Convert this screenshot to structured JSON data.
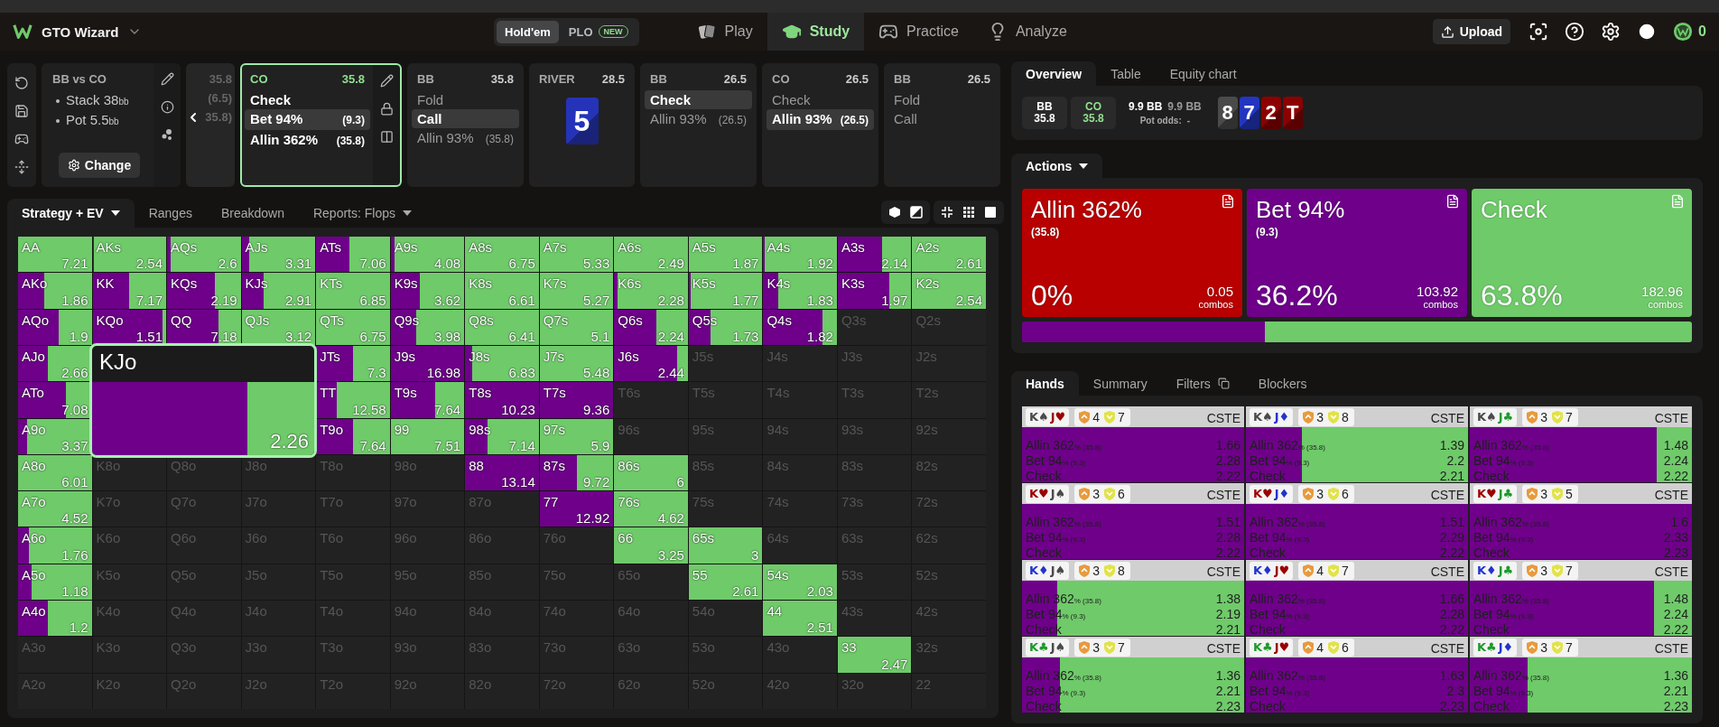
{
  "nav": {
    "brand": "GTO Wizard",
    "games": [
      {
        "label": "Hold'em",
        "selected": true
      },
      {
        "label": "PLO",
        "badge": "NEW",
        "selected": false
      }
    ],
    "links": [
      {
        "label": "Play",
        "kind": "play",
        "selected": false
      },
      {
        "label": "Study",
        "kind": "study",
        "selected": true
      },
      {
        "label": "Practice",
        "kind": "practice",
        "selected": false
      },
      {
        "label": "Analyze",
        "kind": "analyze",
        "selected": false
      }
    ],
    "upload": "Upload",
    "coins": "0"
  },
  "spot": {
    "title": "BB vs CO",
    "stats": [
      "Stack 38$_{bb}$",
      "Pot 5.5$_{bb}$"
    ],
    "change": "Change"
  },
  "hidden_card": {
    "lines": [
      "35.8",
      "(6.5)",
      "35.8)"
    ]
  },
  "line": [
    {
      "kind": "player",
      "position": "CO",
      "stack": "35.8",
      "selected": true,
      "options": [
        {
          "label": "Check",
          "selected": false
        },
        {
          "label": "Bet 94%",
          "amount": "(9.3)",
          "selected": true
        },
        {
          "label": "Allin 362%",
          "amount": "(35.8)",
          "selected": false
        }
      ]
    },
    {
      "kind": "player",
      "position": "BB",
      "stack": "35.8",
      "selected": false,
      "options": [
        {
          "label": "Fold",
          "selected": false
        },
        {
          "label": "Call",
          "selected": true
        },
        {
          "label": "Allin 93%",
          "amount": "(35.8)",
          "selected": false
        }
      ]
    },
    {
      "kind": "street",
      "position": "RIVER",
      "stack": "28.5",
      "selected": false,
      "card": {
        "rank": "5",
        "color": "#2433b8"
      }
    },
    {
      "kind": "player",
      "position": "BB",
      "stack": "26.5",
      "selected": false,
      "options": [
        {
          "label": "Check",
          "selected": true
        },
        {
          "label": "Allin 93%",
          "amount": "(26.5)",
          "selected": false
        }
      ]
    },
    {
      "kind": "player",
      "position": "CO",
      "stack": "26.5",
      "selected": false,
      "options": [
        {
          "label": "Check",
          "selected": false
        },
        {
          "label": "Allin 93%",
          "amount": "(26.5)",
          "selected": true
        }
      ]
    },
    {
      "kind": "player",
      "position": "BB",
      "stack": "26.5",
      "selected": false,
      "options": [
        {
          "label": "Fold",
          "selected": false
        },
        {
          "label": "Call",
          "selected": false
        }
      ]
    }
  ],
  "grid_tabs": [
    {
      "label": "Strategy + EV",
      "dropdown": true,
      "selected": true
    },
    {
      "label": "Ranges",
      "dropdown": false,
      "selected": false
    },
    {
      "label": "Breakdown",
      "dropdown": false,
      "selected": false
    },
    {
      "label": "Reports: Flops",
      "dropdown": true,
      "selected": false
    }
  ],
  "grid": {
    "rows": [
      [
        {
          "hand": "AA",
          "in_range": true,
          "ev": "7.21"
        },
        {
          "hand": "AKs",
          "in_range": true,
          "ev": "2.54",
          "bet": {
            "level": 0.02
          }
        },
        {
          "hand": "AQs",
          "in_range": true,
          "ev": "2.6",
          "bet": {
            "level": 0.05
          }
        },
        {
          "hand": "AJs",
          "in_range": true,
          "ev": "3.31",
          "bet": {
            "level": 0.1
          }
        },
        {
          "hand": "ATs",
          "in_range": true,
          "ev": "7.06",
          "bet": {
            "level": 0.45
          }
        },
        {
          "hand": "A9s",
          "in_range": true,
          "ev": "4.08",
          "bet": {
            "level": 0.05
          }
        },
        {
          "hand": "A8s",
          "in_range": true,
          "ev": "6.75"
        },
        {
          "hand": "A7s",
          "in_range": true,
          "ev": "5.33"
        },
        {
          "hand": "A6s",
          "in_range": true,
          "ev": "2.49"
        },
        {
          "hand": "A5s",
          "in_range": true,
          "ev": "1.87"
        },
        {
          "hand": "A4s",
          "in_range": true,
          "ev": "1.92",
          "bet": {
            "level": 0.02
          }
        },
        {
          "hand": "A3s",
          "in_range": true,
          "ev": "2.14",
          "bet": {
            "level": 0.6
          }
        },
        {
          "hand": "A2s",
          "in_range": true,
          "ev": "2.61"
        }
      ],
      [
        {
          "hand": "AKo",
          "in_range": true,
          "ev": "1.86",
          "bet": {
            "level": 0.35
          }
        },
        {
          "hand": "KK",
          "in_range": true,
          "ev": "7.17",
          "bet": {
            "level": 0.5
          }
        },
        {
          "hand": "KQs",
          "in_range": true,
          "ev": "2.19",
          "bet": {
            "level": 0.65
          }
        },
        {
          "hand": "KJs",
          "in_range": true,
          "ev": "2.91",
          "bet": {
            "level": 0.3
          }
        },
        {
          "hand": "KTs",
          "in_range": true,
          "ev": "6.85"
        },
        {
          "hand": "K9s",
          "in_range": true,
          "ev": "3.62",
          "bet": {
            "level": 0.4
          }
        },
        {
          "hand": "K8s",
          "in_range": true,
          "ev": "6.61"
        },
        {
          "hand": "K7s",
          "in_range": true,
          "ev": "5.27"
        },
        {
          "hand": "K6s",
          "in_range": true,
          "ev": "2.28",
          "bet": {
            "level": 0.05
          }
        },
        {
          "hand": "K5s",
          "in_range": true,
          "ev": "1.77",
          "bet": {
            "level": 0.03
          }
        },
        {
          "hand": "K4s",
          "in_range": true,
          "ev": "1.83",
          "bet": {
            "level": 0.2
          }
        },
        {
          "hand": "K3s",
          "in_range": true,
          "ev": "1.97",
          "bet": {
            "level": 0.7
          }
        },
        {
          "hand": "K2s",
          "in_range": true,
          "ev": "2.54"
        }
      ],
      [
        {
          "hand": "AQo",
          "in_range": true,
          "ev": "1.9",
          "bet": {
            "level": 0.55
          }
        },
        {
          "hand": "KQo",
          "in_range": true,
          "ev": "1.51",
          "bet": {
            "level": 0.95
          }
        },
        {
          "hand": "QQ",
          "in_range": true,
          "ev": "7.18",
          "bet": {
            "level": 0.7
          }
        },
        {
          "hand": "QJs",
          "in_range": true,
          "ev": "3.12"
        },
        {
          "hand": "QTs",
          "in_range": true,
          "ev": "6.75"
        },
        {
          "hand": "Q9s",
          "in_range": true,
          "ev": "3.98",
          "bet": {
            "level": 0.35
          }
        },
        {
          "hand": "Q8s",
          "in_range": true,
          "ev": "6.41"
        },
        {
          "hand": "Q7s",
          "in_range": true,
          "ev": "5.1"
        },
        {
          "hand": "Q6s",
          "in_range": true,
          "ev": "2.24",
          "bet": {
            "level": 0.57
          }
        },
        {
          "hand": "Q5s",
          "in_range": true,
          "ev": "1.73",
          "bet": {
            "level": 0.3
          }
        },
        {
          "hand": "Q4s",
          "in_range": true,
          "ev": "1.82",
          "bet": {
            "level": 0.8
          }
        },
        {
          "hand": "Q3s",
          "in_range": false
        },
        {
          "hand": "Q2s",
          "in_range": false
        }
      ],
      [
        {
          "hand": "AJo",
          "in_range": true,
          "ev": "2.66",
          "bet": {
            "level": 0.4
          }
        },
        null,
        null,
        null,
        {
          "hand": "JTs",
          "in_range": true,
          "ev": "7.3",
          "bet": {
            "level": 0.5
          }
        },
        {
          "hand": "J9s",
          "in_range": true,
          "ev": "16.98",
          "bet": {
            "level": 1
          }
        },
        {
          "hand": "J8s",
          "in_range": true,
          "ev": "6.83",
          "bet": {
            "level": 0.1
          }
        },
        {
          "hand": "J7s",
          "in_range": true,
          "ev": "5.48"
        },
        {
          "hand": "J6s",
          "in_range": true,
          "ev": "2.44",
          "bet": {
            "level": 0.85
          }
        },
        {
          "hand": "J5s",
          "in_range": false
        },
        {
          "hand": "J4s",
          "in_range": false
        },
        {
          "hand": "J3s",
          "in_range": false
        },
        {
          "hand": "J2s",
          "in_range": false
        }
      ],
      [
        {
          "hand": "ATo",
          "in_range": true,
          "ev": "7.08",
          "bet": {
            "level": 0.65
          }
        },
        null,
        null,
        null,
        {
          "hand": "TT",
          "in_range": true,
          "ev": "12.58",
          "bet": {
            "level": 0.28
          }
        },
        {
          "hand": "T9s",
          "in_range": true,
          "ev": "7.64",
          "bet": {
            "level": 0.6
          }
        },
        {
          "hand": "T8s",
          "in_range": true,
          "ev": "10.23",
          "bet": {
            "level": 1
          }
        },
        {
          "hand": "T7s",
          "in_range": true,
          "ev": "9.36",
          "bet": {
            "level": 1
          }
        },
        {
          "hand": "T6s",
          "in_range": false
        },
        {
          "hand": "T5s",
          "in_range": false
        },
        {
          "hand": "T4s",
          "in_range": false
        },
        {
          "hand": "T3s",
          "in_range": false
        },
        {
          "hand": "T2s",
          "in_range": false
        }
      ],
      [
        {
          "hand": "A9o",
          "in_range": true,
          "ev": "3.37",
          "bet": {
            "level": 0.12
          }
        },
        null,
        null,
        null,
        {
          "hand": "T9o",
          "in_range": true,
          "ev": "7.64",
          "bet": {
            "level": 0.5
          }
        },
        {
          "hand": "99",
          "in_range": true,
          "ev": "7.51"
        },
        {
          "hand": "98s",
          "in_range": true,
          "ev": "7.14",
          "bet": {
            "level": 0.3
          }
        },
        {
          "hand": "97s",
          "in_range": true,
          "ev": "5.9"
        },
        {
          "hand": "96s",
          "in_range": false
        },
        {
          "hand": "95s",
          "in_range": false
        },
        {
          "hand": "94s",
          "in_range": false
        },
        {
          "hand": "93s",
          "in_range": false
        },
        {
          "hand": "92s",
          "in_range": false
        }
      ],
      [
        {
          "hand": "A8o",
          "in_range": true,
          "ev": "6.01"
        },
        {
          "hand": "K8o",
          "in_range": false
        },
        {
          "hand": "Q8o",
          "in_range": false
        },
        {
          "hand": "J8o",
          "in_range": false
        },
        {
          "hand": "T8o",
          "in_range": false
        },
        {
          "hand": "98o",
          "in_range": false
        },
        {
          "hand": "88",
          "in_range": true,
          "ev": "13.14",
          "bet": {
            "level": 1
          }
        },
        {
          "hand": "87s",
          "in_range": true,
          "ev": "9.72",
          "bet": {
            "level": 0.5
          }
        },
        {
          "hand": "86s",
          "in_range": true,
          "ev": "6"
        },
        {
          "hand": "85s",
          "in_range": false
        },
        {
          "hand": "84s",
          "in_range": false
        },
        {
          "hand": "83s",
          "in_range": false
        },
        {
          "hand": "82s",
          "in_range": false
        }
      ],
      [
        {
          "hand": "A7o",
          "in_range": true,
          "ev": "4.52"
        },
        {
          "hand": "K7o",
          "in_range": false
        },
        {
          "hand": "Q7o",
          "in_range": false
        },
        {
          "hand": "J7o",
          "in_range": false
        },
        {
          "hand": "T7o",
          "in_range": false
        },
        {
          "hand": "97o",
          "in_range": false
        },
        {
          "hand": "87o",
          "in_range": false
        },
        {
          "hand": "77",
          "in_range": true,
          "ev": "12.92",
          "bet": {
            "level": 1
          }
        },
        {
          "hand": "76s",
          "in_range": true,
          "ev": "4.62"
        },
        {
          "hand": "75s",
          "in_range": false
        },
        {
          "hand": "74s",
          "in_range": false
        },
        {
          "hand": "73s",
          "in_range": false
        },
        {
          "hand": "72s",
          "in_range": false
        }
      ],
      [
        {
          "hand": "A6o",
          "in_range": true,
          "ev": "1.76",
          "bet": {
            "level": 0.15
          }
        },
        {
          "hand": "K6o",
          "in_range": false
        },
        {
          "hand": "Q6o",
          "in_range": false
        },
        {
          "hand": "J6o",
          "in_range": false
        },
        {
          "hand": "T6o",
          "in_range": false
        },
        {
          "hand": "96o",
          "in_range": false
        },
        {
          "hand": "86o",
          "in_range": false
        },
        {
          "hand": "76o",
          "in_range": false
        },
        {
          "hand": "66",
          "in_range": true,
          "ev": "3.25"
        },
        {
          "hand": "65s",
          "in_range": true,
          "ev": "3"
        },
        {
          "hand": "64s",
          "in_range": false
        },
        {
          "hand": "63s",
          "in_range": false
        },
        {
          "hand": "62s",
          "in_range": false
        }
      ],
      [
        {
          "hand": "A5o",
          "in_range": true,
          "ev": "1.18",
          "bet": {
            "level": 0.18
          }
        },
        {
          "hand": "K5o",
          "in_range": false
        },
        {
          "hand": "Q5o",
          "in_range": false
        },
        {
          "hand": "J5o",
          "in_range": false
        },
        {
          "hand": "T5o",
          "in_range": false
        },
        {
          "hand": "95o",
          "in_range": false
        },
        {
          "hand": "85o",
          "in_range": false
        },
        {
          "hand": "75o",
          "in_range": false
        },
        {
          "hand": "65o",
          "in_range": false
        },
        {
          "hand": "55",
          "in_range": true,
          "ev": "2.61"
        },
        {
          "hand": "54s",
          "in_range": true,
          "ev": "2.03"
        },
        {
          "hand": "53s",
          "in_range": false
        },
        {
          "hand": "52s",
          "in_range": false
        }
      ],
      [
        {
          "hand": "A4o",
          "in_range": true,
          "ev": "1.2",
          "bet": {
            "level": 0.4
          }
        },
        {
          "hand": "K4o",
          "in_range": false
        },
        {
          "hand": "Q4o",
          "in_range": false
        },
        {
          "hand": "J4o",
          "in_range": false
        },
        {
          "hand": "T4o",
          "in_range": false
        },
        {
          "hand": "94o",
          "in_range": false
        },
        {
          "hand": "84o",
          "in_range": false
        },
        {
          "hand": "74o",
          "in_range": false
        },
        {
          "hand": "64o",
          "in_range": false
        },
        {
          "hand": "54o",
          "in_range": false
        },
        {
          "hand": "44",
          "in_range": true,
          "ev": "2.51"
        },
        {
          "hand": "43s",
          "in_range": false
        },
        {
          "hand": "42s",
          "in_range": false
        }
      ],
      [
        {
          "hand": "A3o",
          "in_range": false
        },
        {
          "hand": "K3o",
          "in_range": false
        },
        {
          "hand": "Q3o",
          "in_range": false
        },
        {
          "hand": "J3o",
          "in_range": false
        },
        {
          "hand": "T3o",
          "in_range": false
        },
        {
          "hand": "93o",
          "in_range": false
        },
        {
          "hand": "83o",
          "in_range": false
        },
        {
          "hand": "73o",
          "in_range": false
        },
        {
          "hand": "63o",
          "in_range": false
        },
        {
          "hand": "53o",
          "in_range": false
        },
        {
          "hand": "43o",
          "in_range": false
        },
        {
          "hand": "33",
          "in_range": true,
          "ev": "2.47"
        },
        {
          "hand": "32s",
          "in_range": false
        }
      ],
      [
        {
          "hand": "A2o",
          "in_range": false
        },
        {
          "hand": "K2o",
          "in_range": false
        },
        {
          "hand": "Q2o",
          "in_range": false
        },
        {
          "hand": "J2o",
          "in_range": false
        },
        {
          "hand": "T2o",
          "in_range": false
        },
        {
          "hand": "92o",
          "in_range": false
        },
        {
          "hand": "82o",
          "in_range": false
        },
        {
          "hand": "72o",
          "in_range": false
        },
        {
          "hand": "62o",
          "in_range": false
        },
        {
          "hand": "52o",
          "in_range": false
        },
        {
          "hand": "42o",
          "in_range": false
        },
        {
          "hand": "32o",
          "in_range": false
        },
        {
          "hand": "22",
          "in_range": false
        }
      ]
    ],
    "tooltip": {
      "hand": "KJo",
      "ev": "2.26",
      "bet": {
        "level": 0.7
      }
    }
  },
  "overview": {
    "tabs": [
      {
        "label": "Overview",
        "selected": true
      },
      {
        "label": "Table",
        "selected": false
      },
      {
        "label": "Equity chart",
        "selected": false
      }
    ],
    "stacks": [
      {
        "position": "BB",
        "stack": "35.8",
        "selected": false
      },
      {
        "position": "CO",
        "stack": "35.8",
        "selected": true
      }
    ],
    "pot": "9.9 BB",
    "to_call": "9.9 BB",
    "pot_odds_label": "Pot odds:",
    "pot_odds": "-",
    "board": [
      {
        "rank": "8",
        "color": "#4a4a4a"
      },
      {
        "rank": "7",
        "color": "#2436c0"
      },
      {
        "rank": "2",
        "color": "#8c0000"
      },
      {
        "rank": "T",
        "color": "#8c0000"
      }
    ]
  },
  "actions_panel": {
    "tab": "Actions",
    "cards": [
      {
        "kind": "allin",
        "label": "Allin 362%",
        "amount": "(35.8)",
        "share": "0%",
        "combos": "0.05",
        "unit": "combos"
      },
      {
        "kind": "bet",
        "label": "Bet 94%",
        "amount": "(9.3)",
        "share": "36.2%",
        "combos": "103.92",
        "unit": "combos"
      },
      {
        "kind": "check",
        "label": "Check",
        "share": "63.8%",
        "combos": "182.96",
        "unit": "combos"
      }
    ],
    "bar": [
      {
        "kind": "bet",
        "level": 0.362
      },
      {
        "kind": "check",
        "level": 0.638
      }
    ]
  },
  "hands_panel": {
    "tabs": [
      {
        "label": "Hands",
        "kind": "text",
        "selected": true
      },
      {
        "label": "Summary",
        "kind": "text",
        "selected": false
      },
      {
        "label": "Filters",
        "kind": "filter",
        "selected": false
      },
      {
        "label": "Blockers",
        "kind": "text",
        "selected": false
      }
    ],
    "hands": [
      {
        "cards": [
          {
            "text": "K♠",
            "color": "#4a4a4a"
          },
          {
            "text": "J♥",
            "color": "#9a0000"
          }
        ],
        "blockers": [
          "4",
          "7"
        ],
        "tag": "CSTE",
        "bet": {
          "level": 1
        },
        "rows": [
          {
            "label": "Allin 362",
            "size": "% (35.8)",
            "value": "1.66"
          },
          {
            "label": "Bet 94",
            "size": "% (9.3)",
            "value": "2.28"
          },
          {
            "label": "Check",
            "value": "2.22"
          }
        ]
      },
      {
        "cards": [
          {
            "text": "K♠",
            "color": "#4a4a4a"
          },
          {
            "text": "J♦",
            "color": "#2233cc"
          }
        ],
        "blockers": [
          "3",
          "8"
        ],
        "tag": "CSTE",
        "bet": {
          "level": 0.25
        },
        "rows": [
          {
            "label": "Allin 362",
            "size": "% (35.8)",
            "value": "1.39"
          },
          {
            "label": "Bet 94",
            "size": "% (9.3)",
            "value": "2.2"
          },
          {
            "label": "Check",
            "value": "2.21"
          }
        ]
      },
      {
        "cards": [
          {
            "text": "K♠",
            "color": "#4a4a4a"
          },
          {
            "text": "J♣",
            "color": "#1d9a2a"
          }
        ],
        "blockers": [
          "3",
          "7"
        ],
        "tag": "CSTE",
        "bet": {
          "level": 0.84
        },
        "rows": [
          {
            "label": "Allin 362",
            "size": "% (35.8)",
            "value": "1.48"
          },
          {
            "label": "Bet 94",
            "size": "% (9.3)",
            "value": "2.24"
          },
          {
            "label": "Check",
            "value": "2.22"
          }
        ]
      },
      {
        "cards": [
          {
            "text": "K♥",
            "color": "#9a0000"
          },
          {
            "text": "J♠",
            "color": "#4a4a4a"
          }
        ],
        "blockers": [
          "3",
          "6"
        ],
        "tag": "CSTE",
        "bet": {
          "level": 1
        },
        "rows": [
          {
            "label": "Allin 362",
            "size": "% (35.8)",
            "value": "1.51"
          },
          {
            "label": "Bet 94",
            "size": "% (9.3)",
            "value": "2.28"
          },
          {
            "label": "Check",
            "value": "2.22"
          }
        ]
      },
      {
        "cards": [
          {
            "text": "K♥",
            "color": "#9a0000"
          },
          {
            "text": "J♦",
            "color": "#2233cc"
          }
        ],
        "blockers": [
          "3",
          "6"
        ],
        "tag": "CSTE",
        "bet": {
          "level": 1
        },
        "rows": [
          {
            "label": "Allin 362",
            "size": "% (35.8)",
            "value": "1.51"
          },
          {
            "label": "Bet 94",
            "size": "% (9.3)",
            "value": "2.29"
          },
          {
            "label": "Check",
            "value": "2.22"
          }
        ]
      },
      {
        "cards": [
          {
            "text": "K♥",
            "color": "#9a0000"
          },
          {
            "text": "J♣",
            "color": "#1d9a2a"
          }
        ],
        "blockers": [
          "3",
          "5"
        ],
        "tag": "CSTE",
        "bet": {
          "level": 1
        },
        "rows": [
          {
            "label": "Allin 362",
            "size": "% (35.8)",
            "value": "1.6"
          },
          {
            "label": "Bet 94",
            "size": "% (9.3)",
            "value": "2.33"
          },
          {
            "label": "Check",
            "value": "2.23"
          }
        ]
      },
      {
        "cards": [
          {
            "text": "K♦",
            "color": "#2233cc"
          },
          {
            "text": "J♠",
            "color": "#4a4a4a"
          }
        ],
        "blockers": [
          "3",
          "8"
        ],
        "tag": "CSTE",
        "bet": {
          "level": 0.16
        },
        "rows": [
          {
            "label": "Allin 362",
            "size": "% (35.8)",
            "value": "1.38"
          },
          {
            "label": "Bet 94",
            "size": "% (9.3)",
            "value": "2.19"
          },
          {
            "label": "Check",
            "value": "2.21"
          }
        ]
      },
      {
        "cards": [
          {
            "text": "K♦",
            "color": "#2233cc"
          },
          {
            "text": "J♥",
            "color": "#9a0000"
          }
        ],
        "blockers": [
          "4",
          "7"
        ],
        "tag": "CSTE",
        "bet": {
          "level": 1
        },
        "rows": [
          {
            "label": "Allin 362",
            "size": "% (35.8)",
            "value": "1.66"
          },
          {
            "label": "Bet 94",
            "size": "% (9.3)",
            "value": "2.28"
          },
          {
            "label": "Check",
            "value": "2.22"
          }
        ]
      },
      {
        "cards": [
          {
            "text": "K♦",
            "color": "#2233cc"
          },
          {
            "text": "J♣",
            "color": "#1d9a2a"
          }
        ],
        "blockers": [
          "3",
          "7"
        ],
        "tag": "CSTE",
        "bet": {
          "level": 0.83
        },
        "rows": [
          {
            "label": "Allin 362",
            "size": "% (35.8)",
            "value": "1.48"
          },
          {
            "label": "Bet 94",
            "size": "% (9.3)",
            "value": "2.24"
          },
          {
            "label": "Check",
            "value": "2.22"
          }
        ]
      },
      {
        "cards": [
          {
            "text": "K♣",
            "color": "#1d9a2a"
          },
          {
            "text": "J♠",
            "color": "#4a4a4a"
          }
        ],
        "blockers": [
          "3",
          "7"
        ],
        "tag": "CSTE",
        "bet": {
          "level": 0.17
        },
        "rows": [
          {
            "label": "Allin 362",
            "size": "% (35.8)",
            "value": "1.36"
          },
          {
            "label": "Bet 94",
            "size": "% (9.3)",
            "value": "2.21"
          },
          {
            "label": "Check",
            "value": "2.23"
          }
        ]
      },
      {
        "cards": [
          {
            "text": "K♣",
            "color": "#1d9a2a"
          },
          {
            "text": "J♥",
            "color": "#9a0000"
          }
        ],
        "blockers": [
          "4",
          "6"
        ],
        "tag": "CSTE",
        "bet": {
          "level": 1
        },
        "rows": [
          {
            "label": "Allin 362",
            "size": "% (35.8)",
            "value": "1.63"
          },
          {
            "label": "Bet 94",
            "size": "% (9.3)",
            "value": "2.3"
          },
          {
            "label": "Check",
            "value": "2.23"
          }
        ]
      },
      {
        "cards": [
          {
            "text": "K♣",
            "color": "#1d9a2a"
          },
          {
            "text": "J♦",
            "color": "#2233cc"
          }
        ],
        "blockers": [
          "3",
          "7"
        ],
        "tag": "CSTE",
        "bet": {
          "level": 0.26
        },
        "rows": [
          {
            "label": "Allin 362",
            "size": "% (35.8)",
            "value": "1.36"
          },
          {
            "label": "Bet 94",
            "size": "% (9.3)",
            "value": "2.21"
          },
          {
            "label": "Check",
            "value": "2.23"
          }
        ]
      }
    ]
  }
}
